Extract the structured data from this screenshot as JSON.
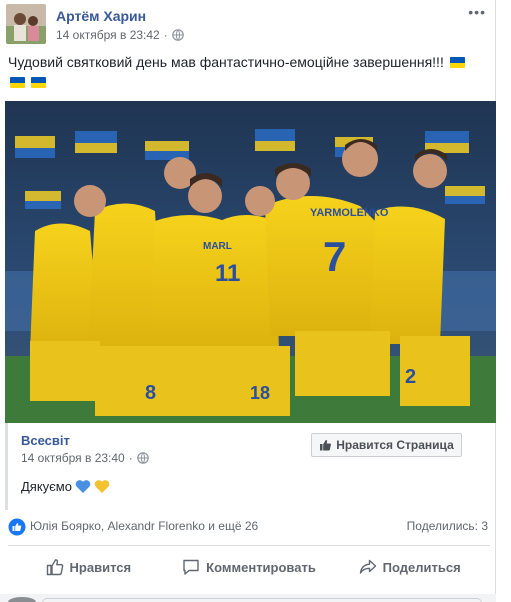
{
  "post": {
    "author": "Артём Харин",
    "timestamp": "14 октября в 23:42",
    "privacy_icon": "globe-icon",
    "options_icon": "more-dots-icon",
    "text": "Чудовий святковий день мав фантастично-емоційне завершення!!!",
    "flag_colors": [
      "#0057b7",
      "#ffd700"
    ]
  },
  "shared_post": {
    "page_name": "Всесвіт",
    "timestamp": "14 октября в 23:40",
    "text": "Дякуємо",
    "heart_colors": [
      "#4a90e2",
      "#f2c230"
    ],
    "like_page_label": "Нравится Страница"
  },
  "reactions": {
    "names": "Юлія Боярко, Alexandr Florenko и ещё 26",
    "shares": "Поделились: 3",
    "icons": [
      "like-icon",
      "love-icon"
    ]
  },
  "actions": {
    "like": "Нравится",
    "comment": "Комментировать",
    "share": "Поделиться"
  },
  "photo": {
    "jersey_names": [
      "YARMOLENKO",
      "MARL"
    ],
    "jersey_numbers": [
      "7",
      "8",
      "11",
      "18",
      "2"
    ]
  }
}
